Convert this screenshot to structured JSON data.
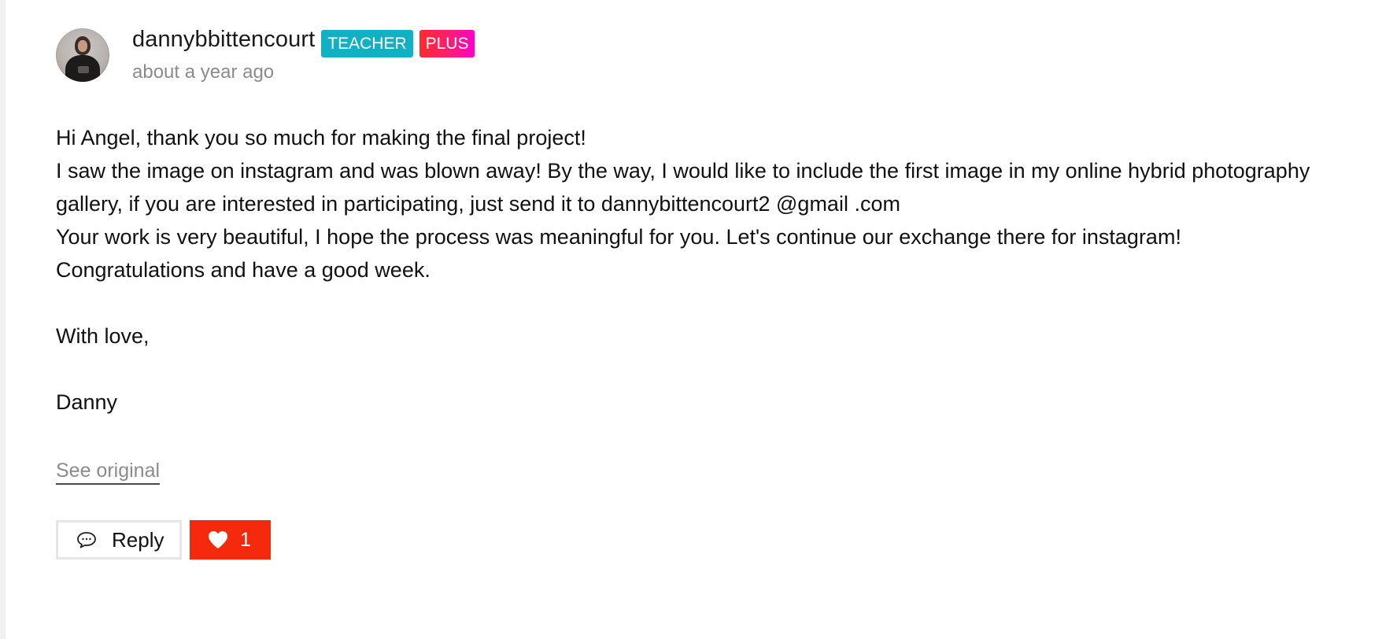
{
  "comment": {
    "username": "dannybbittencourt",
    "badges": {
      "teacher": "TEACHER",
      "plus": "PLUS"
    },
    "timestamp": "about a year ago",
    "paragraphs": [
      "Hi Angel, thank you so much for making the final project!",
      "I saw the image on instagram and was blown away! By the way, I would like to include the first image in my online hybrid photography gallery, if you are interested in participating, just send it to dannybittencourt2 @gmail .com",
      "Your work is very beautiful, I hope the process was meaningful for you. Let's continue our exchange there for instagram!",
      "Congratulations and have a good week."
    ],
    "closing": "With love,",
    "signature": "Danny",
    "see_original": "See original",
    "actions": {
      "reply_label": "Reply",
      "reply_icon": "speech-bubble-icon",
      "like_icon": "heart-icon",
      "like_count": "1"
    }
  },
  "colors": {
    "teacher_badge": "#11b1c3",
    "plus_badge": "#ff1a7a",
    "like_button": "#f52a0c",
    "muted_text": "#8b8b8b"
  }
}
